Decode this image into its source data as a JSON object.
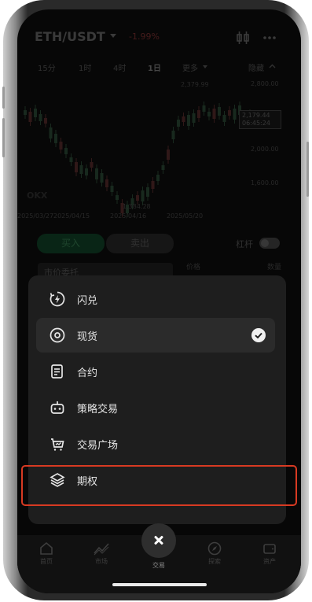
{
  "header": {
    "pair": "ETH/USDT",
    "change": "-1.99%"
  },
  "intervals": {
    "items": [
      "15分",
      "1时",
      "4时",
      "1日"
    ],
    "more": "更多",
    "hide": "隐藏"
  },
  "chart": {
    "price_labels": [
      "2,800.00",
      "2,179.44",
      "2,000.00",
      "1,600.00"
    ],
    "high_label": "2,379.99",
    "low_label": "1,384.28",
    "current_price": "2,179.44",
    "countdown": "06:45:24",
    "date_labels": [
      "2025/03/27",
      "2025/04/15",
      "2025/04/16",
      "2025/05/20"
    ],
    "watermark": "OKX"
  },
  "trade": {
    "buy": "买入",
    "sell": "卖出",
    "leverage": "杠杆",
    "order_type": "市价委托",
    "col_price": "价格",
    "col_qty": "数量"
  },
  "menu": {
    "items": [
      {
        "label": "闪兑",
        "icon": "flash-swap-icon"
      },
      {
        "label": "现货",
        "icon": "spot-icon",
        "selected": true
      },
      {
        "label": "合约",
        "icon": "futures-icon"
      },
      {
        "label": "策略交易",
        "icon": "bot-icon"
      },
      {
        "label": "交易广场",
        "icon": "marketplace-icon"
      },
      {
        "label": "期权",
        "icon": "options-icon",
        "highlighted": true
      }
    ]
  },
  "nav": {
    "items": [
      "首页",
      "市场",
      "交易",
      "探索",
      "资产"
    ],
    "active": "交易"
  },
  "colors": {
    "highlight": "#d83a22",
    "buy": "#0f3a22"
  }
}
